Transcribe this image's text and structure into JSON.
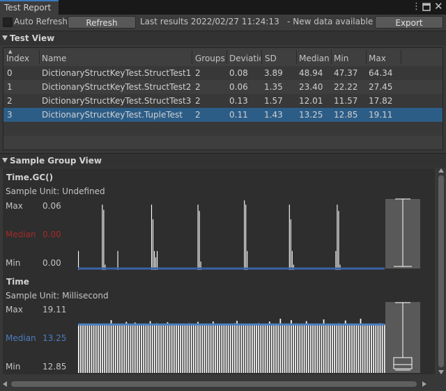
{
  "tab": {
    "title": "Test Report"
  },
  "toolbar": {
    "auto_refresh_label": "Auto Refresh",
    "auto_refresh_checked": false,
    "refresh_label": "Refresh",
    "last_results": "Last results 2022/02/27 11:24:13",
    "new_data": "- New data available",
    "export_label": "Export"
  },
  "test_view": {
    "title": "Test View",
    "columns": [
      "Index",
      "Name",
      "Groups",
      "Deviatio",
      "SD",
      "Median",
      "Min",
      "Max"
    ],
    "rows": [
      {
        "index": "0",
        "name": "DictionaryStructKeyTest.StructTest1",
        "groups": "2",
        "deviation": "0.08",
        "sd": "3.89",
        "median": "48.94",
        "min": "47.37",
        "max": "64.34",
        "selected": false
      },
      {
        "index": "1",
        "name": "DictionaryStructKeyTest.StructTest2",
        "groups": "2",
        "deviation": "0.06",
        "sd": "1.35",
        "median": "23.40",
        "min": "22.22",
        "max": "27.45",
        "selected": false
      },
      {
        "index": "2",
        "name": "DictionaryStructKeyTest.StructTest3",
        "groups": "2",
        "deviation": "0.13",
        "sd": "1.57",
        "median": "12.01",
        "min": "11.57",
        "max": "17.82",
        "selected": false
      },
      {
        "index": "3",
        "name": "DictionaryStructKeyTest.TupleTest",
        "groups": "2",
        "deviation": "0.11",
        "sd": "1.43",
        "median": "13.25",
        "min": "12.85",
        "max": "19.11",
        "selected": true
      }
    ]
  },
  "sample_group_view": {
    "title": "Sample Group View",
    "groups": [
      {
        "name": "Time.GC()",
        "unit": "Sample Unit: Undefined",
        "max_label": "Max",
        "max": "0.06",
        "median_label": "Median",
        "median": "0.00",
        "median_color": "#a52a2a",
        "min_label": "Min",
        "min": "0.00",
        "bar_color": "#ffffff",
        "line_color": "#3a62a7",
        "samples": [
          0.016,
          0,
          0,
          0,
          0,
          0,
          0,
          0,
          0,
          0,
          0,
          0,
          0,
          0,
          0,
          0,
          0,
          0.06,
          0.055,
          0.003,
          0,
          0,
          0,
          0,
          0,
          0,
          0,
          0,
          0.016,
          0,
          0,
          0,
          0,
          0,
          0,
          0,
          0,
          0,
          0,
          0,
          0,
          0,
          0,
          0,
          0,
          0,
          0,
          0,
          0,
          0,
          0,
          0,
          0.06,
          0.046,
          0.016,
          0.01,
          0.016,
          0,
          0,
          0,
          0,
          0,
          0,
          0,
          0,
          0,
          0,
          0,
          0,
          0,
          0,
          0,
          0,
          0,
          0,
          0,
          0,
          0,
          0,
          0,
          0,
          0,
          0,
          0,
          0,
          0.06,
          0.054,
          0.006,
          0,
          0,
          0,
          0,
          0,
          0,
          0,
          0,
          0,
          0,
          0,
          0,
          0,
          0,
          0,
          0,
          0,
          0,
          0,
          0,
          0,
          0,
          0,
          0,
          0,
          0,
          0,
          0,
          0,
          0,
          0.064,
          0.06,
          0.016,
          0,
          0,
          0,
          0,
          0,
          0,
          0,
          0,
          0,
          0,
          0,
          0,
          0,
          0,
          0,
          0,
          0,
          0,
          0,
          0,
          0,
          0,
          0,
          0,
          0,
          0,
          0,
          0,
          0,
          0.06,
          0.046,
          0.016,
          0.003,
          0,
          0,
          0,
          0,
          0,
          0,
          0,
          0,
          0,
          0,
          0,
          0,
          0,
          0,
          0,
          0,
          0,
          0,
          0,
          0,
          0,
          0,
          0,
          0,
          0,
          0,
          0,
          0,
          0,
          0.016,
          0.06,
          0.054,
          0.003,
          0,
          0,
          0,
          0,
          0,
          0,
          0,
          0,
          0,
          0,
          0,
          0,
          0,
          0,
          0,
          0,
          0,
          0,
          0,
          0,
          0,
          0,
          0,
          0,
          0,
          0,
          0,
          0,
          0,
          0,
          0,
          0
        ]
      },
      {
        "name": "Time",
        "unit": "Sample Unit: Millisecond",
        "max_label": "Max",
        "max": "19.11",
        "median_label": "Median",
        "median": "13.25",
        "median_color": "#4a7ec0",
        "min_label": "Min",
        "min": "12.85",
        "bar_color": "#ffffff",
        "line_color": "#4a7ec0",
        "samples": [
          13.3,
          13.2,
          13.4,
          13.3,
          13.2,
          13.5,
          13.3,
          13.4,
          13.2,
          13.1,
          13.5,
          13.4,
          13.3,
          13.2,
          13.4,
          14.5,
          13.3,
          13.2,
          13.4,
          13.3,
          13.2,
          13.3,
          14.0,
          13.5,
          13.2,
          13.3,
          13.8,
          13.4,
          13.2,
          13.1,
          13.3,
          13.5,
          13.4,
          14.2,
          13.3,
          13.2,
          13.6,
          13.2,
          13.3,
          13.4,
          13.5,
          13.9,
          13.2,
          13.3,
          13.4,
          13.3,
          13.2,
          13.5,
          13.3,
          13.4,
          13.2,
          13.6,
          13.3,
          13.2,
          13.4,
          14.0,
          13.3,
          13.5,
          13.2,
          13.4,
          13.3,
          13.2,
          14.1,
          13.3,
          13.5,
          13.2,
          13.4,
          13.3,
          13.2,
          13.5,
          13.4,
          13.3,
          13.6,
          14.3,
          13.2,
          13.4,
          13.3,
          13.2,
          13.5,
          13.3,
          13.4,
          13.2,
          13.3,
          13.6,
          13.5,
          13.2,
          13.4,
          13.3,
          14.1,
          13.2,
          13.3,
          13.4,
          13.3,
          14.9,
          13.2,
          13.4,
          13.5,
          13.3,
          14.5,
          13.2,
          13.4,
          13.3,
          13.5,
          13.2,
          13.3,
          14.2,
          13.4,
          13.3,
          13.2,
          13.5,
          13.3,
          13.4,
          13.2,
          14.7,
          13.3,
          13.4,
          13.5,
          13.2,
          13.3,
          13.4,
          13.6,
          13.2,
          13.3,
          14.4,
          13.3,
          13.2,
          13.4,
          13.5,
          13.3,
          13.2,
          14.9,
          13.4,
          13.3,
          13.2,
          13.5,
          13.3,
          13.4,
          13.2,
          13.3,
          13.6,
          13.4,
          13.3
        ]
      }
    ]
  }
}
